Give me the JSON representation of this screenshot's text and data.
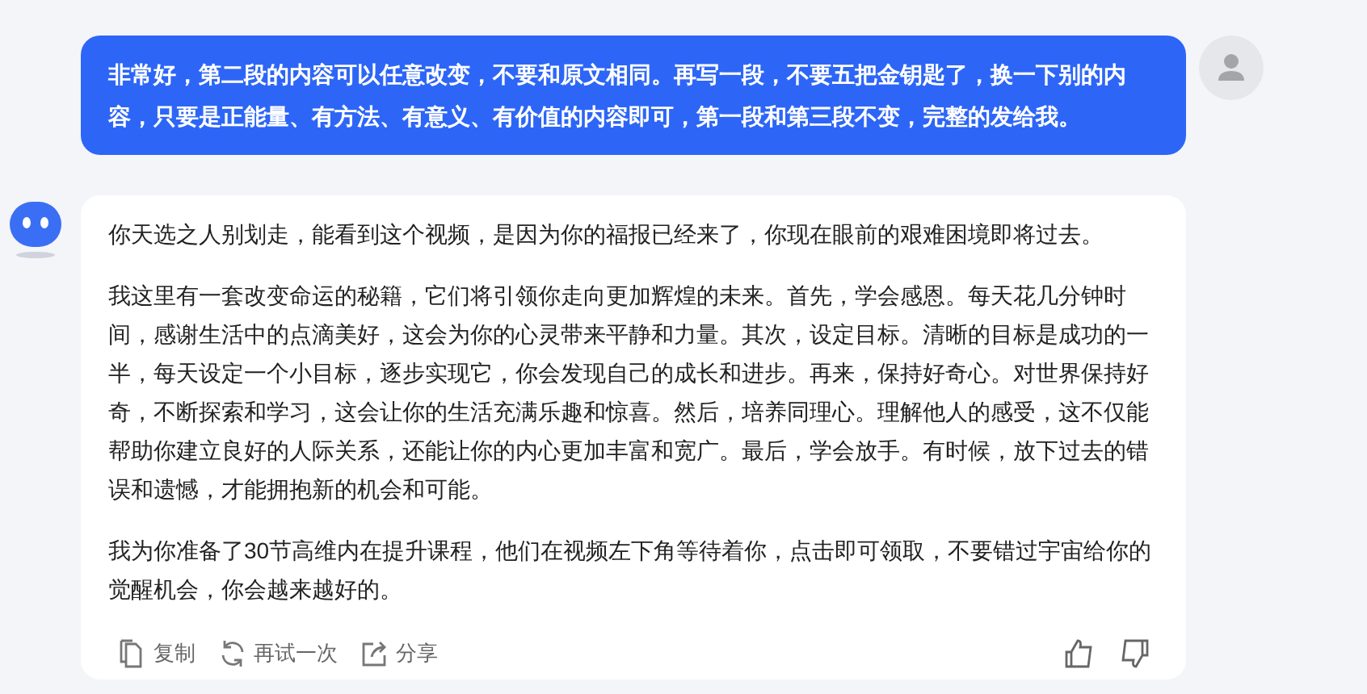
{
  "user_message": {
    "text": "非常好，第二段的内容可以任意改变，不要和原文相同。再写一段，不要五把金钥匙了，换一下别的内容，只要是正能量、有方法、有意义、有价值的内容即可，第一段和第三段不变，完整的发给我。"
  },
  "assistant_message": {
    "paragraphs": [
      "你天选之人别划走，能看到这个视频，是因为你的福报已经来了，你现在眼前的艰难困境即将过去。",
      "我这里有一套改变命运的秘籍，它们将引领你走向更加辉煌的未来。首先，学会感恩。每天花几分钟时间，感谢生活中的点滴美好，这会为你的心灵带来平静和力量。其次，设定目标。清晰的目标是成功的一半，每天设定一个小目标，逐步实现它，你会发现自己的成长和进步。再来，保持好奇心。对世界保持好奇，不断探索和学习，这会让你的生活充满乐趣和惊喜。然后，培养同理心。理解他人的感受，这不仅能帮助你建立良好的人际关系，还能让你的内心更加丰富和宽广。最后，学会放手。有时候，放下过去的错误和遗憾，才能拥抱新的机会和可能。",
      "我为你准备了30节高维内在提升课程，他们在视频左下角等待着你，点击即可领取，不要错过宇宙给你的觉醒机会，你会越来越好的。"
    ],
    "actions": [
      {
        "kind": "copy",
        "label": "复制"
      },
      {
        "kind": "retry",
        "label": "再试一次"
      },
      {
        "kind": "share",
        "label": "分享"
      }
    ]
  }
}
